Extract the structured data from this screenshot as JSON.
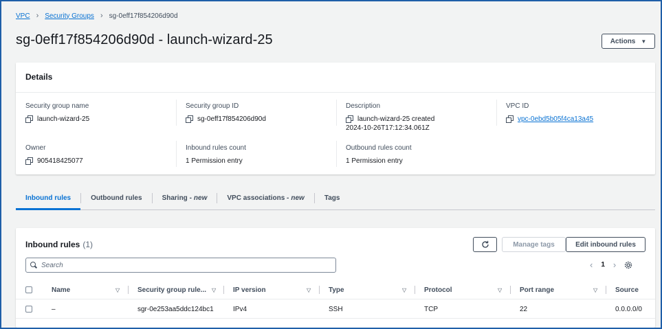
{
  "breadcrumb": {
    "items": [
      {
        "label": "VPC"
      },
      {
        "label": "Security Groups"
      }
    ],
    "current": "sg-0eff17f854206d90d"
  },
  "page": {
    "title": "sg-0eff17f854206d90d - launch-wizard-25",
    "actions_label": "Actions"
  },
  "details": {
    "title": "Details",
    "sg_name": {
      "label": "Security group name",
      "value": "launch-wizard-25"
    },
    "sg_id": {
      "label": "Security group ID",
      "value": "sg-0eff17f854206d90d"
    },
    "description": {
      "label": "Description",
      "value_line1": "launch-wizard-25 created",
      "value_line2": "2024-10-26T17:12:34.061Z"
    },
    "vpc_id": {
      "label": "VPC ID",
      "value": "vpc-0ebd5b05f4ca13a45"
    },
    "owner": {
      "label": "Owner",
      "value": "905418425077"
    },
    "inbound_count": {
      "label": "Inbound rules count",
      "value": "1 Permission entry"
    },
    "outbound_count": {
      "label": "Outbound rules count",
      "value": "1 Permission entry"
    }
  },
  "tabs": [
    {
      "label": "Inbound rules",
      "active": true
    },
    {
      "label": "Outbound rules"
    },
    {
      "label": "Sharing -",
      "suffix": "new"
    },
    {
      "label": "VPC associations -",
      "suffix": "new"
    },
    {
      "label": "Tags"
    }
  ],
  "rules": {
    "title": "Inbound rules",
    "count": "(1)",
    "manage_tags_label": "Manage tags",
    "edit_label": "Edit inbound rules",
    "search_placeholder": "Search",
    "page": "1",
    "columns": [
      "Name",
      "Security group rule...",
      "IP version",
      "Type",
      "Protocol",
      "Port range",
      "Source"
    ],
    "rows": [
      {
        "name": "–",
        "rule_id": "sgr-0e253aa5ddc124bc1",
        "ip_version": "IPv4",
        "type": "SSH",
        "protocol": "TCP",
        "port_range": "22",
        "source": "0.0.0.0/0"
      }
    ]
  },
  "colors": {
    "accent": "#0972d3",
    "frame_border": "#1f5fa8"
  },
  "icons": [
    "chevron-right-icon",
    "copy-icon",
    "caret-down-icon",
    "refresh-icon",
    "search-icon",
    "chevron-left-icon",
    "settings-gear-icon",
    "sort-icon"
  ]
}
